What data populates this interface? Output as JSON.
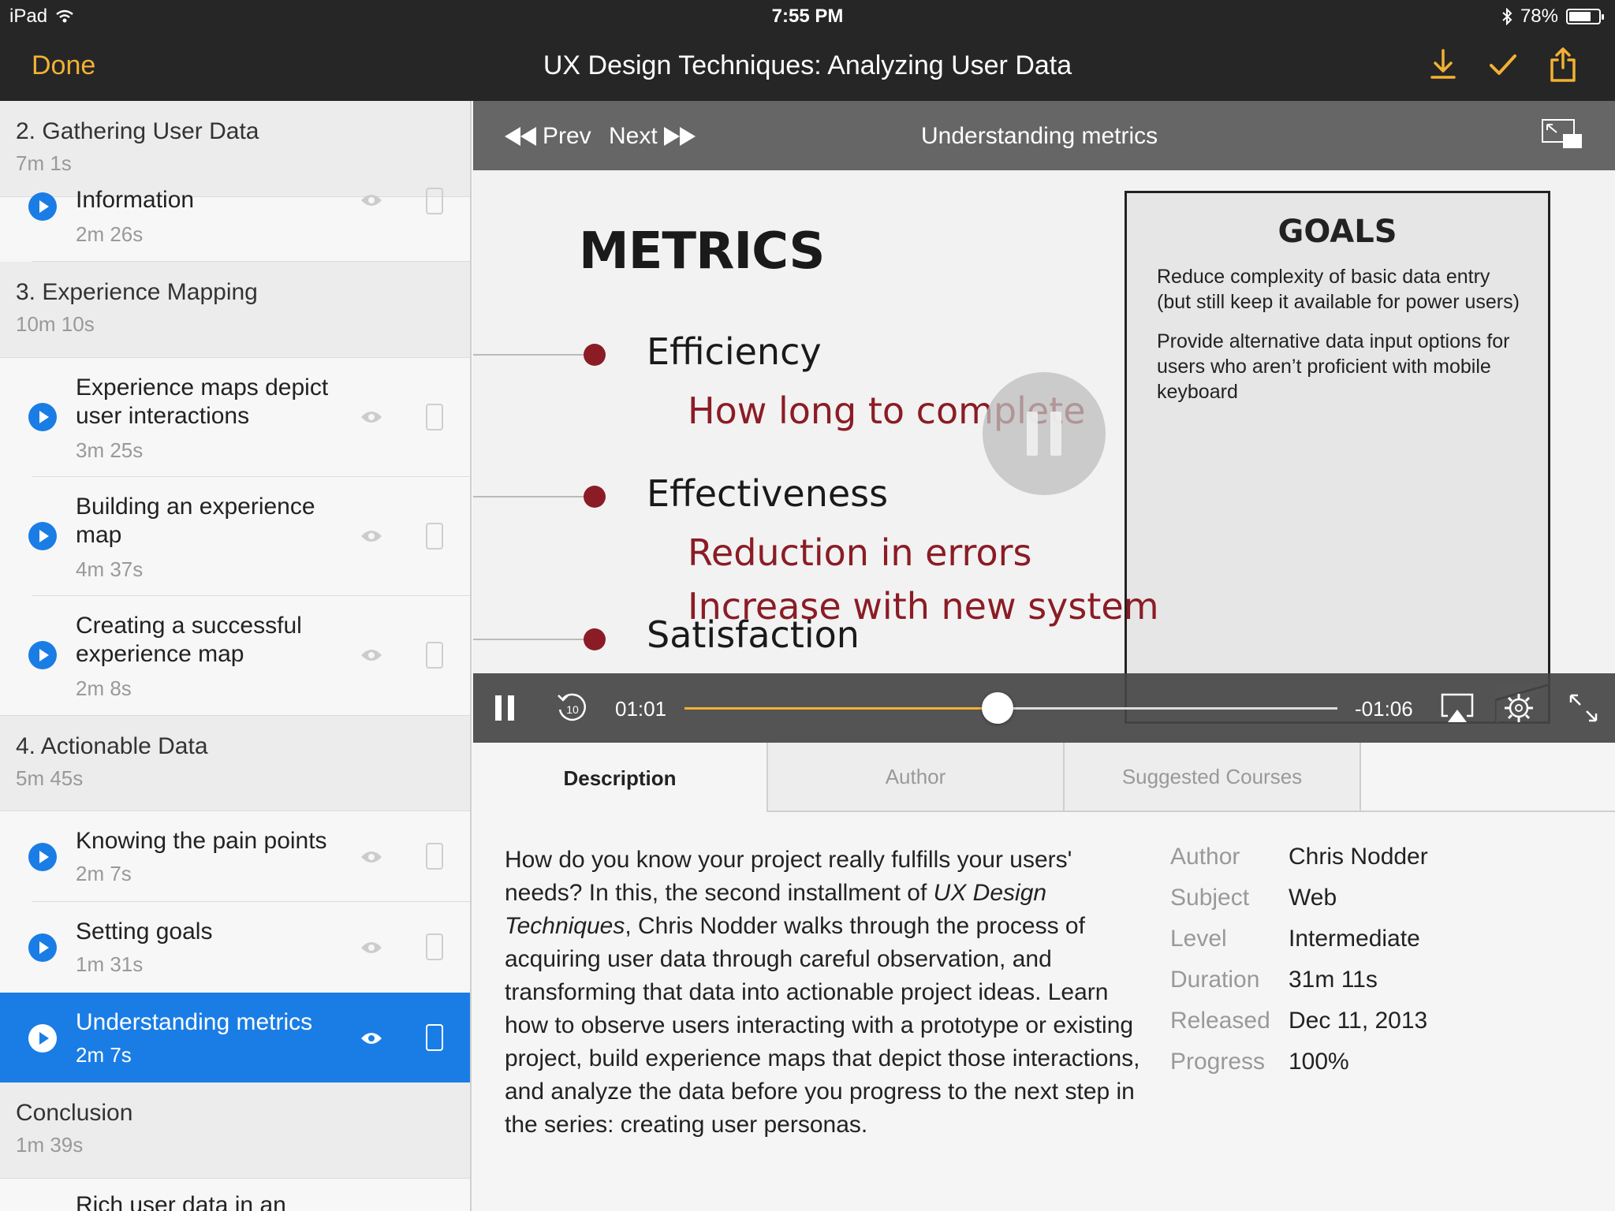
{
  "status": {
    "device": "iPad",
    "time": "7:55 PM",
    "battery": "78%",
    "battery_level": 0.78
  },
  "nav": {
    "done": "Done",
    "title": "UX Design Techniques: Analyzing User Data"
  },
  "sidebar": {
    "sections": [
      {
        "title": "2. Gathering User Data",
        "duration": "7m 1s",
        "items": [
          {
            "label": "Information",
            "duration": "2m 26s"
          }
        ]
      },
      {
        "title": "3. Experience Mapping",
        "duration": "10m 10s",
        "items": [
          {
            "label": "Experience maps depict user interactions",
            "duration": "3m 25s"
          },
          {
            "label": "Building an experience map",
            "duration": "4m 37s"
          },
          {
            "label": "Creating a successful experience map",
            "duration": "2m 8s"
          }
        ]
      },
      {
        "title": "4. Actionable Data",
        "duration": "5m 45s",
        "items": [
          {
            "label": "Knowing the pain points",
            "duration": "2m 7s"
          },
          {
            "label": "Setting goals",
            "duration": "1m 31s"
          },
          {
            "label": "Understanding metrics",
            "duration": "2m 7s",
            "active": true
          }
        ]
      },
      {
        "title": "Conclusion",
        "duration": "1m 39s",
        "items": [
          {
            "label": "Rich user data in an",
            "duration": ""
          }
        ]
      }
    ]
  },
  "video": {
    "prev": "Prev",
    "next": "Next",
    "title": "Understanding metrics",
    "elapsed": "01:01",
    "remaining": "-01:06",
    "progress": 0.48,
    "slide": {
      "heading": "METRICS",
      "metrics": [
        {
          "label": "Efficiency",
          "detail": "How long to complete"
        },
        {
          "label": "Effectiveness",
          "detail": "Reduction in errors"
        },
        {
          "label": "Satisfaction",
          "detail": "Increase with new system"
        }
      ],
      "goals_title": "GOALS",
      "goals": [
        "Reduce complexity of basic data entry (but still keep it available for power users)",
        "Provide alternative data input options for users who aren’t proficient with mobile keyboard"
      ]
    }
  },
  "tabs": [
    "Description",
    "Author",
    "Suggested Courses"
  ],
  "description": {
    "part1": "How do you know your project really fulfills your users' needs? In this, the second installment of ",
    "italic": "UX Design Techniques",
    "part2": ", Chris Nodder walks through the process of acquiring user data through careful observation, and transforming that data into actionable project ideas. Learn how to observe users interacting with a prototype or existing project, build experience maps that depict those interactions, and analyze the data before you progress to the next step in the series: creating user personas."
  },
  "meta": [
    {
      "key": "Author",
      "value": "Chris Nodder"
    },
    {
      "key": "Subject",
      "value": "Web"
    },
    {
      "key": "Level",
      "value": "Intermediate"
    },
    {
      "key": "Duration",
      "value": "31m 11s"
    },
    {
      "key": "Released",
      "value": "Dec 11, 2013"
    },
    {
      "key": "Progress",
      "value": "100%"
    }
  ],
  "colors": {
    "accent": "#f2b134",
    "active": "#1a7de5",
    "metric_red": "#8b1c25",
    "bar": "#262626"
  },
  "icons": [
    "wifi-icon",
    "bluetooth-icon",
    "battery-icon",
    "download-icon",
    "checkmark-icon",
    "share-icon",
    "rewind-prev-icon",
    "forward-next-icon",
    "picture-in-picture-icon",
    "pause-icon",
    "replay-10-icon",
    "airplay-icon",
    "gear-icon",
    "fullscreen-icon",
    "play-icon",
    "eye-icon",
    "device-icon"
  ]
}
